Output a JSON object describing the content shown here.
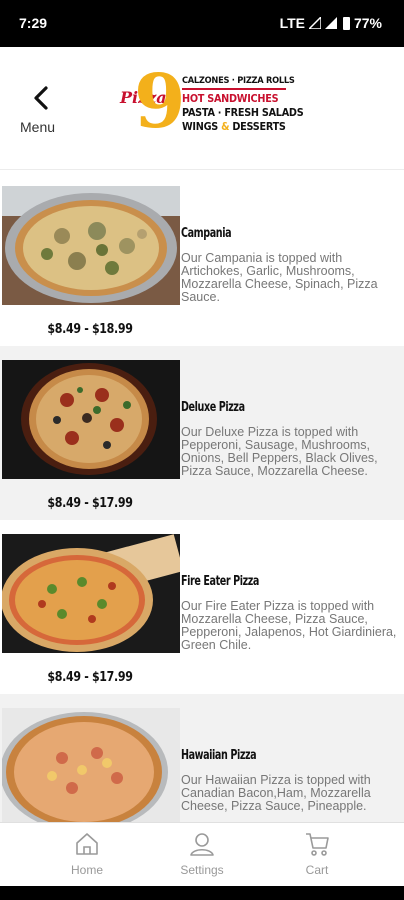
{
  "status": {
    "time": "7:29",
    "network": "LTE",
    "battery": "77%"
  },
  "header": {
    "back_label": "Menu",
    "logo": {
      "brand": "Pizza",
      "number": "9",
      "line1": "CALZONES · PIZZA ROLLS",
      "line2": "HOT SANDWICHES",
      "line3": "PASTA · FRESH SALADS",
      "line4a": "WINGS",
      "line4b": "&",
      "line4c": "DESSERTS"
    }
  },
  "items": [
    {
      "title": "Campania",
      "description": "Our Campania is topped with Artichokes, Garlic, Mushrooms, Mozzarella Cheese, Spinach, Pizza Sauce.",
      "price": "$8.49 - $18.99"
    },
    {
      "title": "Deluxe Pizza",
      "description": "Our Deluxe Pizza is topped with Pepperoni, Sausage, Mushrooms, Onions, Bell Peppers, Black Olives, Pizza Sauce, Mozzarella Cheese.",
      "price": "$8.49 - $17.99"
    },
    {
      "title": "Fire Eater Pizza",
      "description": "Our Fire Eater Pizza is topped with Mozzarella Cheese, Pizza Sauce, Pepperoni, Jalapenos, Hot Giardiniera, Green Chile.",
      "price": "$8.49 - $17.99"
    },
    {
      "title": "Hawaiian Pizza",
      "description": "Our Hawaiian Pizza is topped with Canadian Bacon,Ham, Mozzarella Cheese, Pizza Sauce, Pineapple.",
      "price": ""
    }
  ],
  "nav": {
    "home": "Home",
    "settings": "Settings",
    "cart": "Cart"
  }
}
